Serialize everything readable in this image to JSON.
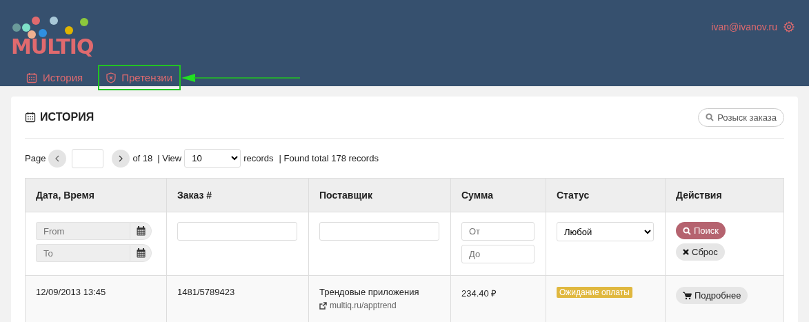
{
  "header": {
    "logo": "MULTIQ",
    "user_email": "ivan@ivanov.ru",
    "nav": [
      {
        "label": "История",
        "kind": "calendar",
        "selected": false,
        "highlighted": false
      },
      {
        "label": "Претензии",
        "kind": "shield",
        "selected": false,
        "highlighted": true
      }
    ]
  },
  "panel": {
    "title": "ИСТОРИЯ",
    "search_button": "Розыск заказа",
    "pager": {
      "page_label": "Page",
      "of_label": "of 18",
      "view_label": "| View",
      "page_size": "10",
      "records_label": "records",
      "found_label": "| Found total 178 records"
    },
    "table": {
      "columns": [
        "Дата, Время",
        "Заказ #",
        "Поставщик",
        "Сумма",
        "Статус",
        "Действия"
      ],
      "filters": {
        "date_from_placeholder": "From",
        "date_to_placeholder": "To",
        "sum_from_placeholder": "От",
        "sum_to_placeholder": "До",
        "status_value": "Любой",
        "search_button": "Поиск",
        "reset_button": "Сброс"
      },
      "rows": [
        {
          "datetime": "12/09/2013 13:45",
          "order": "1481/5789423",
          "supplier": "Трендовые приложения",
          "supplier_link": "multiq.ru/apptrend",
          "amount": "234.40 ₽",
          "status": "Ожидание оплаты",
          "details_button": "Подробнее"
        }
      ]
    }
  }
}
